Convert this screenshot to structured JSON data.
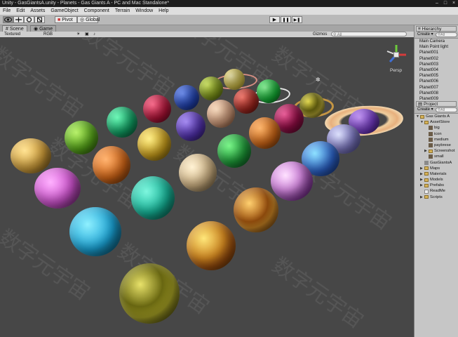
{
  "window": {
    "title": "Unity - GasGiantsA.unity - Planets - Gas Giants A - PC and Mac Standalone*"
  },
  "window_controls": [
    "–",
    "□",
    "×"
  ],
  "menu": [
    "File",
    "Edit",
    "Assets",
    "GameObject",
    "Component",
    "Terrain",
    "Window",
    "Help"
  ],
  "toolbar": {
    "pivot_label": "Pivot",
    "global_label": "Global",
    "play_icon": "▶",
    "pause_icon": "❚❚",
    "step_icon": "▶❚",
    "tool_icons": [
      "hand-icon",
      "move-icon",
      "rotate-icon",
      "scale-icon"
    ]
  },
  "tabs": {
    "scene": "Scene",
    "game": "Game"
  },
  "scene_bar": {
    "shading": "Textured",
    "render_mode": "RGB",
    "gizmos": "Gizmos",
    "search_placeholder": "All"
  },
  "viewport": {
    "persp_label": "Persp",
    "watermark": "数字元宇宙"
  },
  "hierarchy": {
    "tab": "Hierarchy",
    "create": "Create",
    "search": "All",
    "items": [
      "Main Camera",
      "Main Point light",
      "Planet001",
      "Planet002",
      "Planet003",
      "Planet004",
      "Planet005",
      "Planet006",
      "Planet007",
      "Planet008",
      "Planet009"
    ]
  },
  "project": {
    "tab": "Project",
    "create": "Create",
    "search": "All",
    "items": [
      {
        "label": "Gas Giants A",
        "kind": "folder",
        "level": 0,
        "arrow": "▼"
      },
      {
        "label": "AssetStore",
        "kind": "folder",
        "level": 1,
        "arrow": "▼"
      },
      {
        "label": "big",
        "kind": "thumb",
        "level": 2,
        "arrow": ""
      },
      {
        "label": "icon",
        "kind": "thumb",
        "level": 2,
        "arrow": ""
      },
      {
        "label": "medium",
        "kind": "thumb",
        "level": 2,
        "arrow": ""
      },
      {
        "label": "paybrese",
        "kind": "thumb",
        "level": 2,
        "arrow": ""
      },
      {
        "label": "Screenshot",
        "kind": "folder",
        "level": 2,
        "arrow": "▶"
      },
      {
        "label": "small",
        "kind": "thumb",
        "level": 2,
        "arrow": ""
      },
      {
        "label": "GasGiantsA",
        "kind": "thumb",
        "level": 1,
        "arrow": ""
      },
      {
        "label": "Maps",
        "kind": "folder",
        "level": 1,
        "arrow": "▶"
      },
      {
        "label": "Materials",
        "kind": "folder",
        "level": 1,
        "arrow": "▶"
      },
      {
        "label": "Models",
        "kind": "folder",
        "level": 1,
        "arrow": "▶"
      },
      {
        "label": "Prefabs",
        "kind": "folder",
        "level": 1,
        "arrow": "▶"
      },
      {
        "label": "ReadMe",
        "kind": "thumb",
        "level": 1,
        "arrow": ""
      },
      {
        "label": "Scripts",
        "kind": "folder",
        "level": 1,
        "arrow": "▶"
      }
    ]
  },
  "colors": {
    "viewport_bg": "#474747",
    "panel_bg": "#c2c2c2",
    "gizmo_x": "#d43b3b",
    "gizmo_y": "#6ccb3c",
    "gizmo_z": "#3f6fd6"
  }
}
